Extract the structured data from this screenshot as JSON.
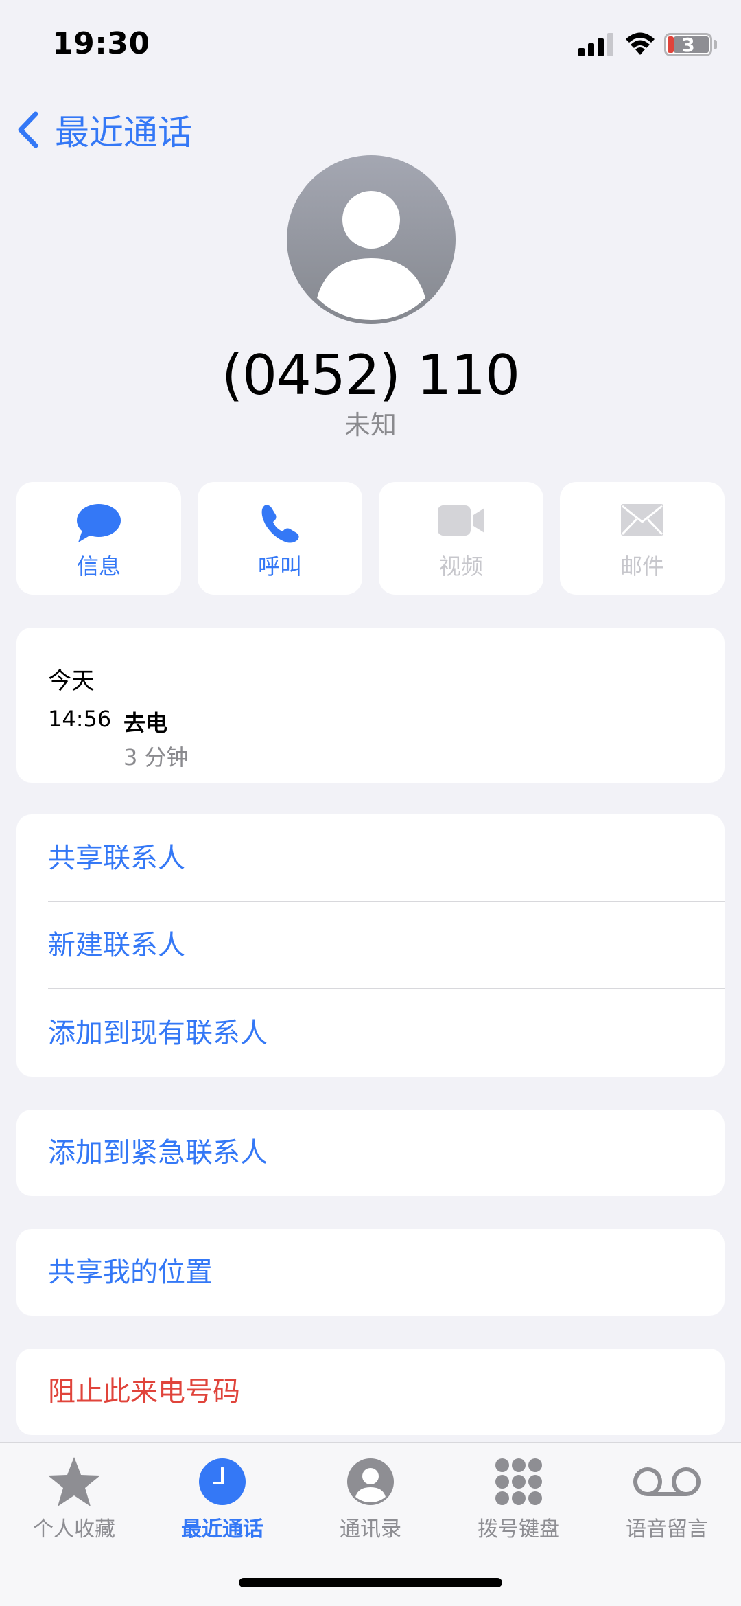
{
  "status": {
    "time": "19:30",
    "battery": "3",
    "battery_color": "#e0443b"
  },
  "nav": {
    "back_label": "最近通话"
  },
  "contact": {
    "number": "(0452) 110",
    "label": "未知"
  },
  "actions": [
    {
      "label": "信息",
      "icon": "message-bubble-icon",
      "enabled": true
    },
    {
      "label": "呼叫",
      "icon": "phone-icon",
      "enabled": true
    },
    {
      "label": "视频",
      "icon": "video-camera-icon",
      "enabled": false
    },
    {
      "label": "邮件",
      "icon": "envelope-icon",
      "enabled": false
    }
  ],
  "history": {
    "day": "今天",
    "time": "14:56",
    "type": "去电",
    "duration": "3 分钟"
  },
  "contact_options": [
    {
      "label": "共享联系人"
    },
    {
      "label": "新建联系人"
    },
    {
      "label": "添加到现有联系人"
    }
  ],
  "emergency": {
    "label": "添加到紧急联系人"
  },
  "location": {
    "label": "共享我的位置"
  },
  "block": {
    "label": "阻止此来电号码"
  },
  "tabs": [
    {
      "label": "个人收藏",
      "icon": "star-icon",
      "active": false
    },
    {
      "label": "最近通话",
      "icon": "clock-icon",
      "active": true
    },
    {
      "label": "通讯录",
      "icon": "person-circle-icon",
      "active": false
    },
    {
      "label": "拨号键盘",
      "icon": "keypad-icon",
      "active": false
    },
    {
      "label": "语音留言",
      "icon": "voicemail-icon",
      "active": false
    }
  ],
  "colors": {
    "accent": "#3478f6",
    "destructive": "#e0443b",
    "background": "#f2f2f7"
  }
}
